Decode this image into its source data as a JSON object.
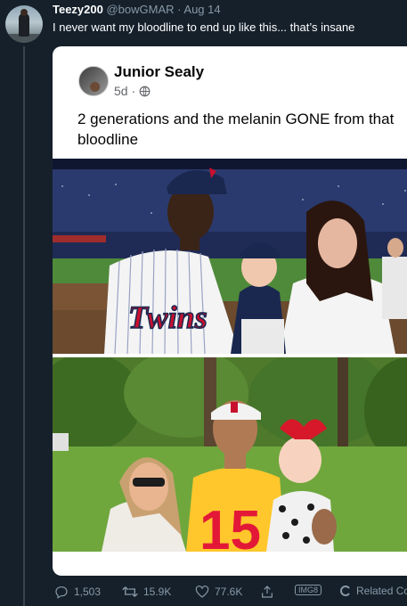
{
  "tweet": {
    "display_name": "Teezy200",
    "handle": "@bowGMAR",
    "separator": "·",
    "date": "Aug 14",
    "text": "I never want my bloodline to end up like this... that’s insane"
  },
  "card": {
    "author": "Junior Sealy",
    "time": "5d",
    "separator": "·",
    "post_text": "2 generations and the melanin GONE from that bloodline",
    "photo1_jersey_text": "Twins",
    "photo2_jersey_number": "15"
  },
  "actions": {
    "replies": "1,503",
    "retweets": "15.9K",
    "likes": "77.6K",
    "imgs_badge": "IMG8",
    "related": "Related Conve"
  },
  "colors": {
    "background": "#15202b",
    "muted": "#8899a6",
    "card_bg": "#ffffff"
  }
}
